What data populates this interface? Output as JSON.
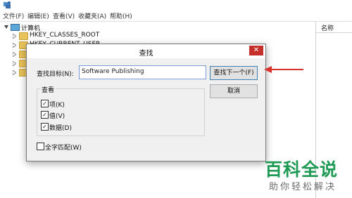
{
  "menubar": {
    "items": [
      "文件(F)",
      "编辑(E)",
      "查看(V)",
      "收藏夹(A)",
      "帮助(H)"
    ]
  },
  "tree": {
    "computer_label": "计算机",
    "nodes": [
      "HKEY_CLASSES_ROOT",
      "HKEY_CURRENT_USER"
    ]
  },
  "right_pane": {
    "column_header": "名称"
  },
  "find_dialog": {
    "title": "查找",
    "close_glyph": "✕",
    "find_what_label": "查找目标(N):",
    "find_what_value": "Software Publishing",
    "find_next_label": "查找下一个(F)",
    "cancel_label": "取消",
    "look_at_group_label": "查看",
    "options": [
      {
        "label": "项(K)",
        "checked": true
      },
      {
        "label": "值(V)",
        "checked": true
      },
      {
        "label": "数据(D)",
        "checked": true
      }
    ],
    "match_whole_label": "全字匹配(W)",
    "match_whole_checked": false
  },
  "annotation": {
    "color": "#d9312b"
  },
  "watermark": {
    "title": "百科全说",
    "subtitle": "助你轻松解决",
    "color": "#1f9a55"
  }
}
